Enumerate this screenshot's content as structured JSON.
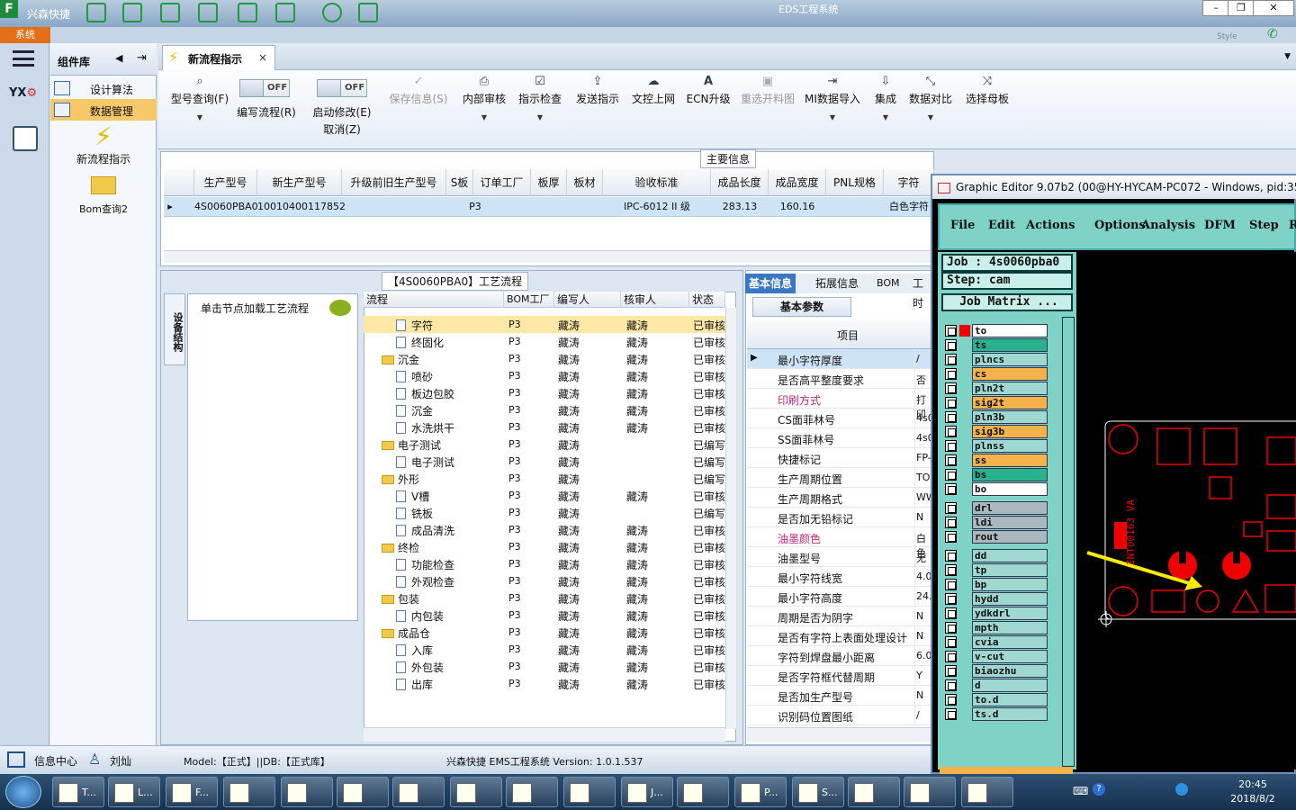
{
  "app": {
    "title": "兴森快捷",
    "center_title": "EDS工程系统",
    "system_menu": "系统",
    "style_label": "Style"
  },
  "left_lib": {
    "header": "组件库",
    "items": [
      {
        "label": "设计算法"
      },
      {
        "label": "数据管理"
      }
    ],
    "big_items": [
      {
        "label": "新流程指示"
      },
      {
        "label": "Bom查询2"
      }
    ]
  },
  "tab": {
    "label": "新流程指示",
    "close": "×"
  },
  "toolbar": {
    "buttons": [
      {
        "label": "型号查询(F)",
        "icon": "search-icon",
        "dropdown": true,
        "enabled": true
      },
      {
        "label": "编写流程(R)",
        "toggle": "OFF",
        "enabled": true
      },
      {
        "label": "启动修改(E)",
        "label2": "取消(Z)",
        "toggle": "OFF",
        "enabled": true
      },
      {
        "label": "保存信息(S)",
        "icon": "check-icon",
        "enabled": false
      },
      {
        "label": "内部审核",
        "icon": "printer-icon",
        "dropdown": true,
        "enabled": true
      },
      {
        "label": "指示检查",
        "icon": "checkbox-icon",
        "dropdown": true,
        "enabled": true
      },
      {
        "label": "发送指示",
        "icon": "upload-icon",
        "enabled": true
      },
      {
        "label": "文控上网",
        "icon": "cloud-upload-icon",
        "enabled": true
      },
      {
        "label": "ECN升级",
        "icon": "font-icon",
        "enabled": true
      },
      {
        "label": "重选开料图",
        "icon": "image-icon",
        "enabled": false
      },
      {
        "label": "MI数据导入",
        "icon": "sign-in-icon",
        "dropdown": true,
        "enabled": true
      },
      {
        "label": "集成",
        "icon": "download-icon",
        "dropdown": true,
        "enabled": true
      },
      {
        "label": "数据对比",
        "icon": "compress-icon",
        "dropdown": true,
        "enabled": true
      },
      {
        "label": "选择母板",
        "icon": "shuffle-icon",
        "enabled": true
      }
    ]
  },
  "main_info": {
    "section_label": "主要信息",
    "columns": [
      "生产型号",
      "新生产型号",
      "升级前旧生产型号",
      "S板",
      "订单工厂",
      "板厚",
      "板材",
      "验收标准",
      "成品长度",
      "成品宽度",
      "PNL规格",
      "字符"
    ],
    "rows": [
      [
        "4S0060PBA0",
        "10010400117852",
        "",
        "",
        "P3",
        "",
        "",
        "IPC-6012 II 级",
        "283.13",
        "160.16",
        "",
        "白色字符"
      ]
    ]
  },
  "process": {
    "section_label": "【4S0060PBA0】工艺流程",
    "side_tab": "设备结构",
    "node_hint": "单击节点加载工艺流程",
    "columns": [
      "流程",
      "BOM工厂",
      "编写人",
      "核审人",
      "状态"
    ],
    "rows": [
      {
        "name": "字符",
        "level": 2,
        "type": "doc",
        "bom": "P3",
        "writer": "藏涛",
        "reviewer": "藏涛",
        "status": "已审核",
        "selected": true
      },
      {
        "name": "终固化",
        "level": 2,
        "type": "doc",
        "bom": "P3",
        "writer": "藏涛",
        "reviewer": "藏涛",
        "status": "已审核"
      },
      {
        "name": "沉金",
        "level": 1,
        "type": "folder",
        "bom": "P3",
        "writer": "藏涛",
        "reviewer": "藏涛",
        "status": "已审核"
      },
      {
        "name": "喷砂",
        "level": 2,
        "type": "doc",
        "bom": "P3",
        "writer": "藏涛",
        "reviewer": "藏涛",
        "status": "已审核"
      },
      {
        "name": "板边包胶",
        "level": 2,
        "type": "doc",
        "bom": "P3",
        "writer": "藏涛",
        "reviewer": "藏涛",
        "status": "已审核"
      },
      {
        "name": "沉金",
        "level": 2,
        "type": "doc",
        "bom": "P3",
        "writer": "藏涛",
        "reviewer": "藏涛",
        "status": "已审核"
      },
      {
        "name": "水洗烘干",
        "level": 2,
        "type": "doc",
        "bom": "P3",
        "writer": "藏涛",
        "reviewer": "藏涛",
        "status": "已审核"
      },
      {
        "name": "电子测试",
        "level": 1,
        "type": "folder",
        "bom": "P3",
        "writer": "藏涛",
        "reviewer": "",
        "status": "已编写"
      },
      {
        "name": "电子测试",
        "level": 2,
        "type": "doc",
        "bom": "P3",
        "writer": "藏涛",
        "reviewer": "",
        "status": "已编写"
      },
      {
        "name": "外形",
        "level": 1,
        "type": "folder",
        "bom": "P3",
        "writer": "藏涛",
        "reviewer": "",
        "status": "已编写"
      },
      {
        "name": "V槽",
        "level": 2,
        "type": "doc",
        "bom": "P3",
        "writer": "藏涛",
        "reviewer": "藏涛",
        "status": "已审核"
      },
      {
        "name": "铣板",
        "level": 2,
        "type": "doc",
        "bom": "P3",
        "writer": "藏涛",
        "reviewer": "",
        "status": "已编写"
      },
      {
        "name": "成品清洗",
        "level": 2,
        "type": "doc",
        "bom": "P3",
        "writer": "藏涛",
        "reviewer": "藏涛",
        "status": "已审核"
      },
      {
        "name": "终检",
        "level": 1,
        "type": "folder",
        "bom": "P3",
        "writer": "藏涛",
        "reviewer": "藏涛",
        "status": "已审核"
      },
      {
        "name": "功能检查",
        "level": 2,
        "type": "doc",
        "bom": "P3",
        "writer": "藏涛",
        "reviewer": "藏涛",
        "status": "已审核"
      },
      {
        "name": "外观检查",
        "level": 2,
        "type": "doc",
        "bom": "P3",
        "writer": "藏涛",
        "reviewer": "藏涛",
        "status": "已审核"
      },
      {
        "name": "包装",
        "level": 1,
        "type": "folder",
        "bom": "P3",
        "writer": "藏涛",
        "reviewer": "藏涛",
        "status": "已审核"
      },
      {
        "name": "内包装",
        "level": 2,
        "type": "doc",
        "bom": "P3",
        "writer": "藏涛",
        "reviewer": "藏涛",
        "status": "已审核"
      },
      {
        "name": "成品仓",
        "level": 1,
        "type": "folder",
        "bom": "P3",
        "writer": "藏涛",
        "reviewer": "藏涛",
        "status": "已审核"
      },
      {
        "name": "入库",
        "level": 2,
        "type": "doc",
        "bom": "P3",
        "writer": "藏涛",
        "reviewer": "藏涛",
        "status": "已审核"
      },
      {
        "name": "外包装",
        "level": 2,
        "type": "doc",
        "bom": "P3",
        "writer": "藏涛",
        "reviewer": "藏涛",
        "status": "已审核"
      },
      {
        "name": "出库",
        "level": 2,
        "type": "doc",
        "bom": "P3",
        "writer": "藏涛",
        "reviewer": "藏涛",
        "status": "已审核"
      }
    ]
  },
  "basic": {
    "tabs": [
      "基本信息",
      "拓展信息",
      "BOM",
      "工时"
    ],
    "subtab": "基本参数",
    "header": "项目",
    "rows": [
      {
        "k": "最小字符厚度",
        "v": "/",
        "selected": true
      },
      {
        "k": "是否高平整度要求",
        "v": "否"
      },
      {
        "k": "印刷方式",
        "v": "打印",
        "pink": true
      },
      {
        "k": "CS面菲林号",
        "v": "4s0"
      },
      {
        "k": "SS面菲林号",
        "v": "4s0"
      },
      {
        "k": "快捷标记",
        "v": "FP-"
      },
      {
        "k": "生产周期位置",
        "v": "TO"
      },
      {
        "k": "生产周期格式",
        "v": "WW"
      },
      {
        "k": "是否加无铅标记",
        "v": "N"
      },
      {
        "k": "油墨颜色",
        "v": "白色",
        "pink": true
      },
      {
        "k": "油墨型号",
        "v": "无"
      },
      {
        "k": "最小字符线宽",
        "v": "4.0"
      },
      {
        "k": "最小字符高度",
        "v": "24."
      },
      {
        "k": "周期是否为阴字",
        "v": "N"
      },
      {
        "k": "是否有字符上表面处理设计",
        "v": "N"
      },
      {
        "k": "字符到焊盘最小距离",
        "v": "6.0"
      },
      {
        "k": "是否字符框代替周期",
        "v": "Y"
      },
      {
        "k": "是否加生产型号",
        "v": "N"
      },
      {
        "k": "识别码位置图纸",
        "v": "/"
      }
    ]
  },
  "graphic_editor": {
    "title": "Graphic Editor 9.07b2 (00@HY-HYCAM-PC072 - Windows, pid:35",
    "menu": [
      "File",
      "Edit",
      "Actions",
      "Options",
      "Analysis",
      "DFM",
      "Step",
      "R"
    ],
    "job": "Job  : 4s0060pba0",
    "step": "Step: cam",
    "matrix_btn": "Job Matrix ...",
    "layers": [
      {
        "name": "to",
        "color": "#ffffff",
        "first": true
      },
      {
        "name": "ts",
        "color": "#28b38e"
      },
      {
        "name": "plncs",
        "color": "#9ed8d0"
      },
      {
        "name": "cs",
        "color": "#f3b24a"
      },
      {
        "name": "pln2t",
        "color": "#9ed8d0"
      },
      {
        "name": "sig2t",
        "color": "#f3b24a"
      },
      {
        "name": "pln3b",
        "color": "#9ed8d0"
      },
      {
        "name": "sig3b",
        "color": "#f3b24a"
      },
      {
        "name": "plnss",
        "color": "#9ed8d0"
      },
      {
        "name": "ss",
        "color": "#f3b24a"
      },
      {
        "name": "bs",
        "color": "#28b38e"
      },
      {
        "name": "bo",
        "color": "#ffffff"
      },
      {
        "name": "drl",
        "color": "#a9b8bf",
        "gap": true
      },
      {
        "name": "ldi",
        "color": "#a9b8bf"
      },
      {
        "name": "rout",
        "color": "#a9b8bf"
      },
      {
        "name": "dd",
        "color": "#9ed8d0",
        "gap": true
      },
      {
        "name": "tp",
        "color": "#9ed8d0"
      },
      {
        "name": "bp",
        "color": "#9ed8d0"
      },
      {
        "name": "hydd",
        "color": "#9ed8d0"
      },
      {
        "name": "ydkdrl",
        "color": "#9ed8d0"
      },
      {
        "name": "mpth",
        "color": "#9ed8d0"
      },
      {
        "name": "cvia",
        "color": "#9ed8d0"
      },
      {
        "name": "v-cut",
        "color": "#9ed8d0"
      },
      {
        "name": "biaozhu",
        "color": "#9ed8d0"
      },
      {
        "name": "d",
        "color": "#9ed8d0"
      },
      {
        "name": "to.d",
        "color": "#9ed8d0"
      },
      {
        "name": "ts.d",
        "color": "#9ed8d0"
      }
    ],
    "board_text": "INT00163 VA"
  },
  "status": {
    "center": "信息中心",
    "user": "刘灿",
    "model": "Model:【正式】||DB:【正式库】",
    "app": "兴森快捷 EMS工程系统 Version: 1.0.1.537"
  },
  "taskbar": {
    "items": [
      "T...",
      "L...",
      "F...",
      "",
      "",
      "",
      "",
      "",
      "",
      "",
      "J...",
      "",
      "P...",
      "S...",
      "",
      ""
    ],
    "time": "20:45",
    "date": "2018/8/2"
  }
}
